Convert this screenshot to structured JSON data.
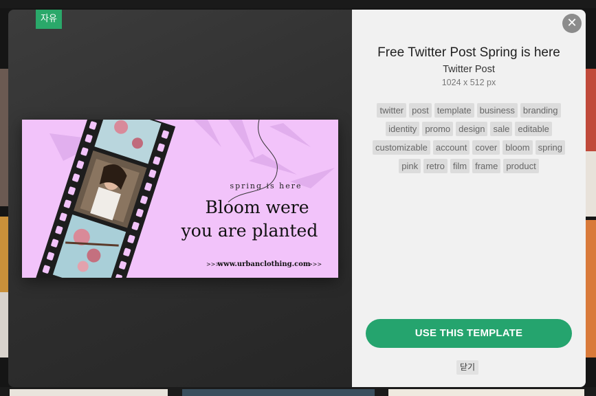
{
  "badge": {
    "label": "자유"
  },
  "template": {
    "title": "Free Twitter Post Spring is here",
    "type": "Twitter Post",
    "dimensions": "1024 x 512 px",
    "tags": [
      "twitter",
      "post",
      "template",
      "business",
      "branding",
      "identity",
      "promo",
      "design",
      "sale",
      "editable",
      "customizable",
      "account",
      "cover",
      "bloom",
      "spring",
      "pink",
      "retro",
      "film",
      "frame",
      "product"
    ]
  },
  "preview": {
    "kicker": "spring is here",
    "headline_line1": "Bloom were",
    "headline_line2": "you are planted",
    "url_left": ">>>",
    "url": "www.urbanclothing.com",
    "url_right": ">>>",
    "bg_color": "#f3c6fb",
    "accent_color": "#1a1a1a"
  },
  "actions": {
    "use_template": "USE THIS TEMPLATE",
    "close": "닫기",
    "close_icon": "close-icon"
  },
  "colors": {
    "brand_green": "#25a46e",
    "badge_green": "#2aa86a"
  }
}
